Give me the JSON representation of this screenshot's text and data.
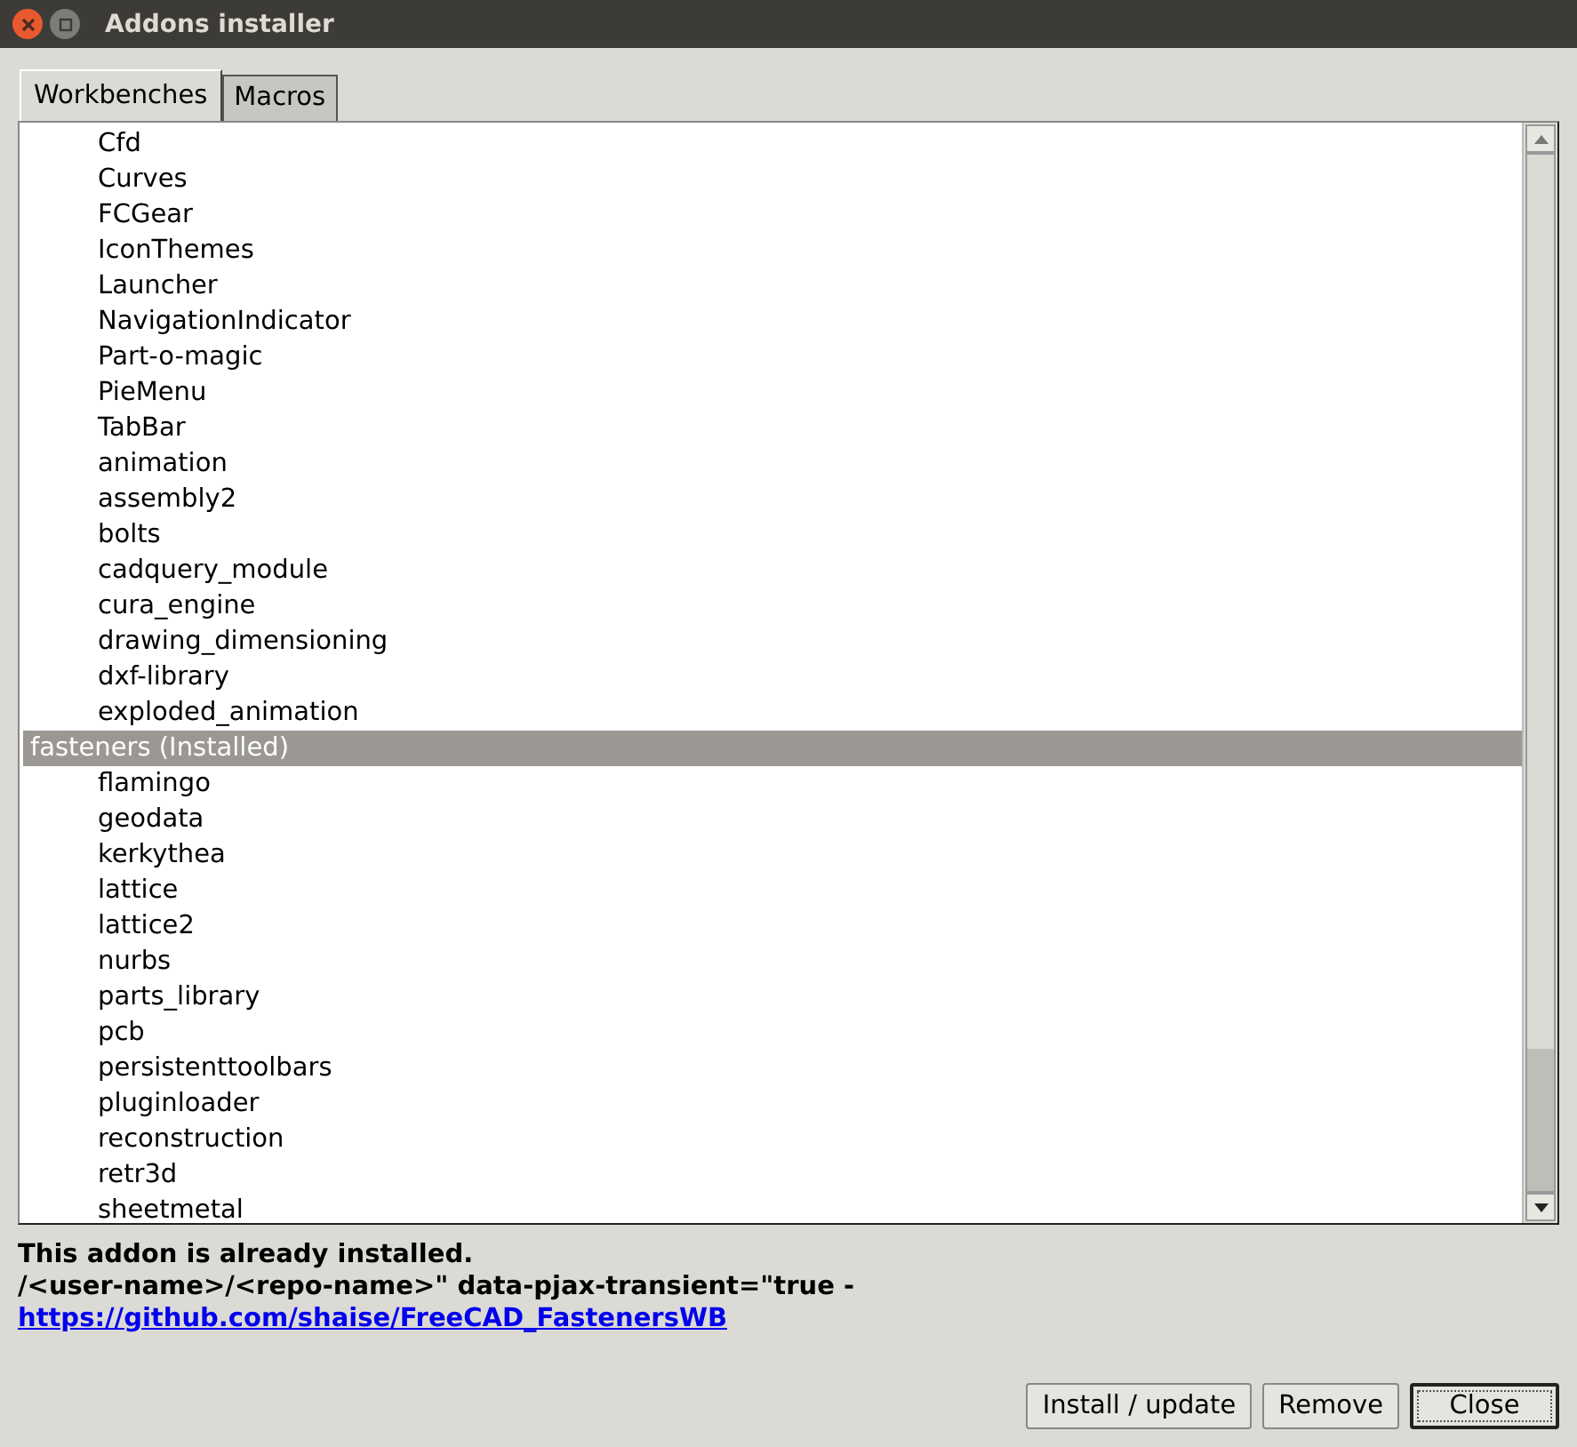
{
  "window": {
    "title": "Addons installer"
  },
  "tabs": [
    {
      "label": "Workbenches",
      "selected": true
    },
    {
      "label": "Macros",
      "selected": false
    }
  ],
  "addons": [
    {
      "name": "Cfd",
      "installed": false,
      "selected": false
    },
    {
      "name": "Curves",
      "installed": false,
      "selected": false
    },
    {
      "name": "FCGear",
      "installed": false,
      "selected": false
    },
    {
      "name": "IconThemes",
      "installed": false,
      "selected": false
    },
    {
      "name": "Launcher",
      "installed": false,
      "selected": false
    },
    {
      "name": "NavigationIndicator",
      "installed": false,
      "selected": false
    },
    {
      "name": "Part-o-magic",
      "installed": false,
      "selected": false
    },
    {
      "name": "PieMenu",
      "installed": false,
      "selected": false
    },
    {
      "name": "TabBar",
      "installed": false,
      "selected": false
    },
    {
      "name": "animation",
      "installed": false,
      "selected": false
    },
    {
      "name": "assembly2",
      "installed": false,
      "selected": false
    },
    {
      "name": "bolts",
      "installed": false,
      "selected": false
    },
    {
      "name": "cadquery_module",
      "installed": false,
      "selected": false
    },
    {
      "name": "cura_engine",
      "installed": false,
      "selected": false
    },
    {
      "name": "drawing_dimensioning",
      "installed": false,
      "selected": false
    },
    {
      "name": "dxf-library",
      "installed": false,
      "selected": false
    },
    {
      "name": "exploded_animation",
      "installed": false,
      "selected": false
    },
    {
      "name": "fasteners (Installed)",
      "installed": true,
      "selected": true
    },
    {
      "name": "flamingo",
      "installed": false,
      "selected": false
    },
    {
      "name": "geodata",
      "installed": false,
      "selected": false
    },
    {
      "name": "kerkythea",
      "installed": false,
      "selected": false
    },
    {
      "name": "lattice",
      "installed": false,
      "selected": false
    },
    {
      "name": "lattice2",
      "installed": false,
      "selected": false
    },
    {
      "name": "nurbs",
      "installed": false,
      "selected": false
    },
    {
      "name": "parts_library",
      "installed": false,
      "selected": false
    },
    {
      "name": "pcb",
      "installed": false,
      "selected": false
    },
    {
      "name": "persistenttoolbars",
      "installed": false,
      "selected": false
    },
    {
      "name": "pluginloader",
      "installed": false,
      "selected": false
    },
    {
      "name": "reconstruction",
      "installed": false,
      "selected": false
    },
    {
      "name": "retr3d",
      "installed": false,
      "selected": false
    },
    {
      "name": "sheetmetal",
      "installed": false,
      "selected": false
    }
  ],
  "message": {
    "status": "This addon is already installed.",
    "detail": "/<user-name>/<repo-name>\" data-pjax-transient=\"true -",
    "link": "https://github.com/shaise/FreeCAD_FastenersWB"
  },
  "buttons": [
    {
      "label": "Install / update",
      "default": false
    },
    {
      "label": "Remove",
      "default": false
    },
    {
      "label": "Close",
      "default": true
    }
  ]
}
